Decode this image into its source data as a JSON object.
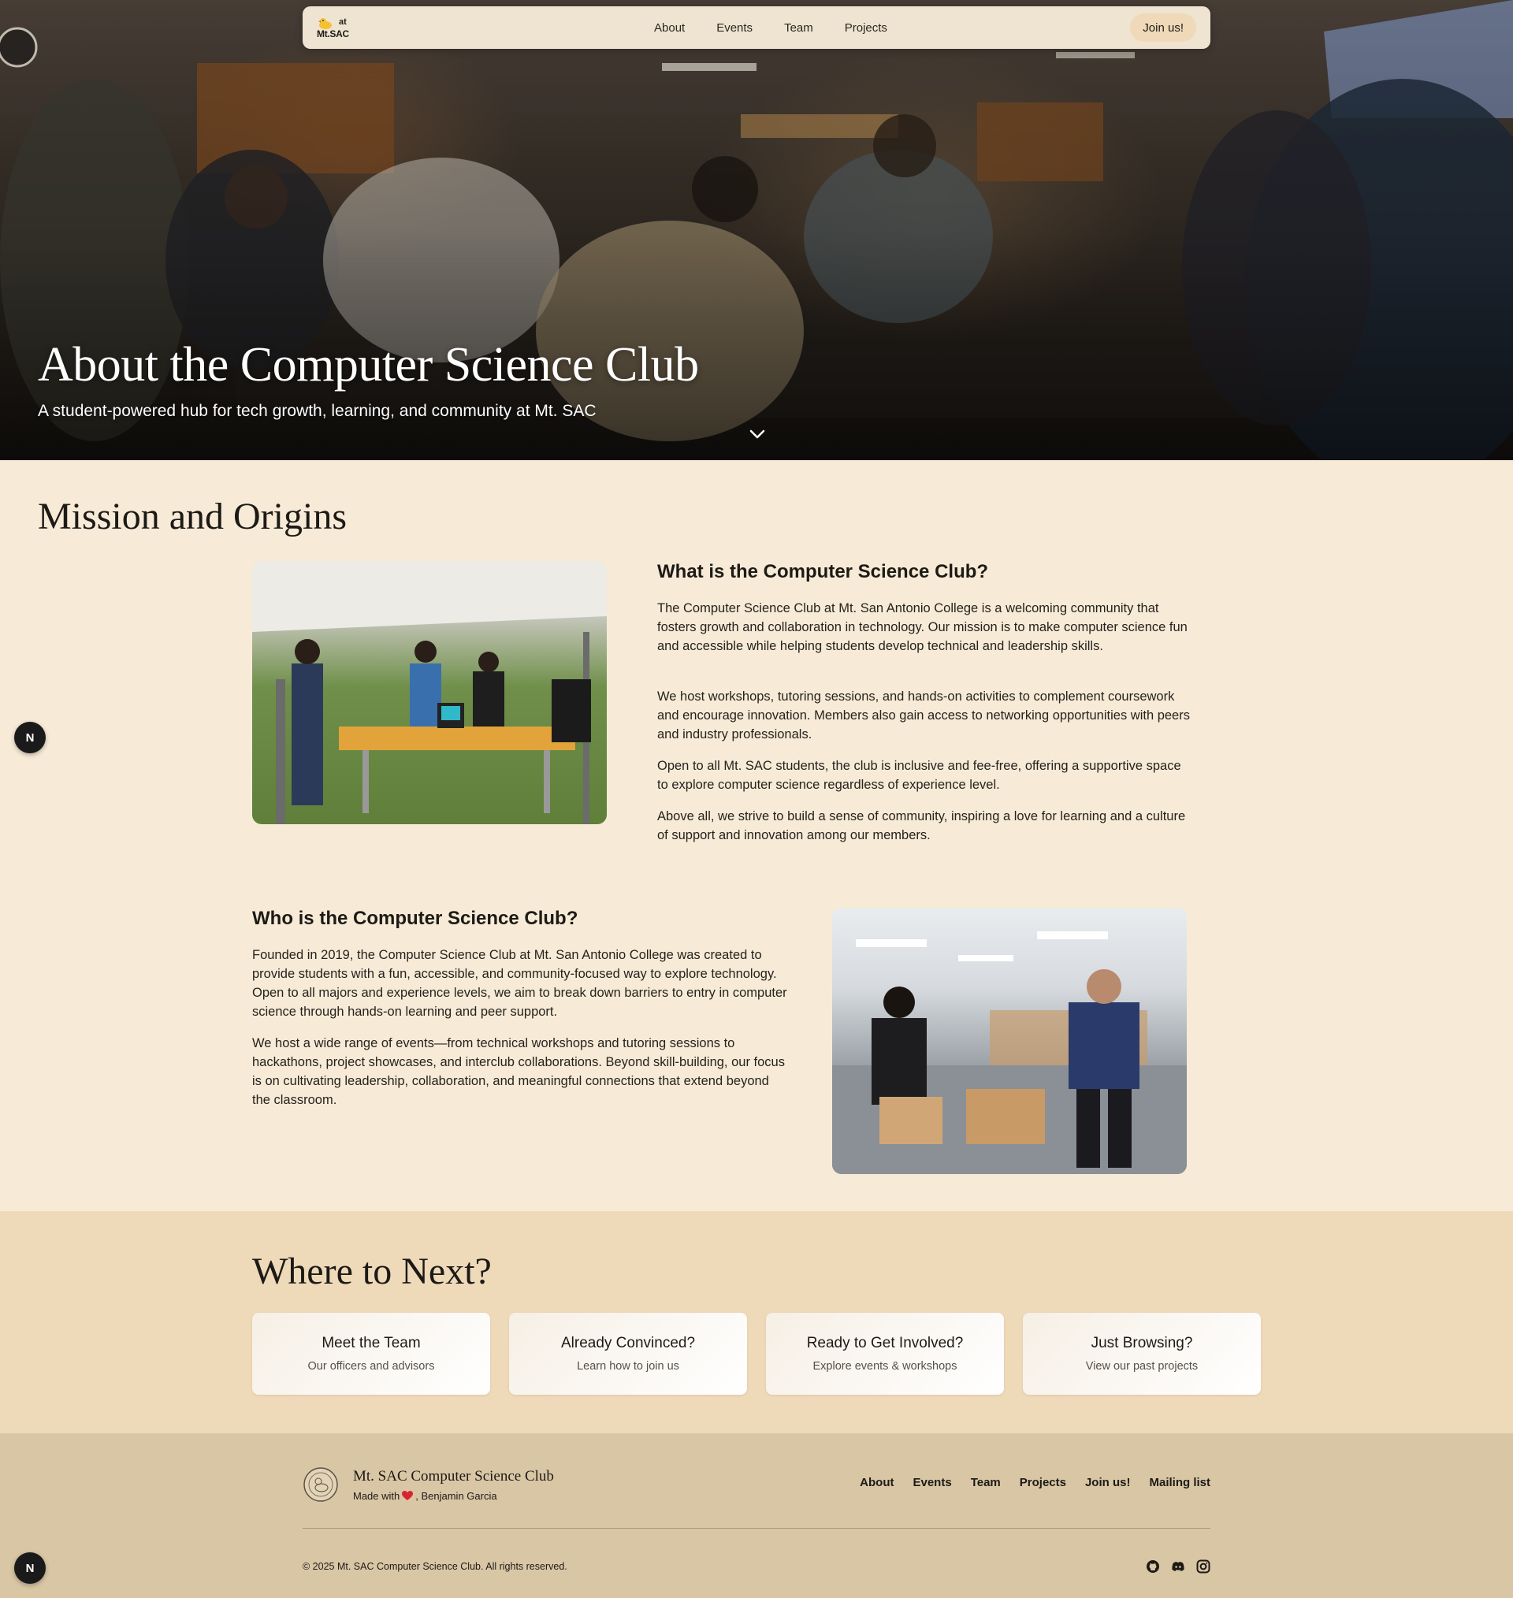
{
  "nav": {
    "logo_at": "at",
    "logo_name": "Mt.SAC",
    "links": [
      "About",
      "Events",
      "Team",
      "Projects"
    ],
    "join_label": "Join us!"
  },
  "hero": {
    "title": "About the Computer Science Club",
    "subtitle": "A student-powered hub for tech growth, learning, and community at Mt. SAC"
  },
  "mission": {
    "title": "Mission and Origins",
    "what": {
      "heading": "What is the Computer Science Club?",
      "paragraphs": [
        "The Computer Science Club at Mt. San Antonio College is a welcoming community that fosters growth and collaboration in technology. Our mission is to make computer science fun and accessible while helping students develop technical and leadership skills.",
        "We host workshops, tutoring sessions, and hands-on activities to complement coursework and encourage innovation. Members also gain access to networking opportunities with peers and industry professionals.",
        "Open to all Mt. SAC students, the club is inclusive and fee-free, offering a supportive space to explore computer science regardless of experience level.",
        "Above all, we strive to build a sense of community, inspiring a love for learning and a culture of support and innovation among our members."
      ]
    },
    "who": {
      "heading": "Who is the Computer Science Club?",
      "paragraphs": [
        "Founded in 2019, the Computer Science Club at Mt. San Antonio College was created to provide students with a fun, accessible, and community-focused way to explore technology. Open to all majors and experience levels, we aim to break down barriers to entry in computer science through hands-on learning and peer support.",
        "We host a wide range of events—from technical workshops and tutoring sessions to hackathons, project showcases, and interclub collaborations. Beyond skill-building, our focus is on cultivating leadership, collaboration, and meaningful connections that extend beyond the classroom."
      ]
    }
  },
  "next": {
    "title": "Where to Next?",
    "cards": [
      {
        "title": "Meet the Team",
        "sub": "Our officers and advisors"
      },
      {
        "title": "Already Convinced?",
        "sub": "Learn how to join us"
      },
      {
        "title": "Ready to Get Involved?",
        "sub": "Explore events & workshops"
      },
      {
        "title": "Just Browsing?",
        "sub": "View our past projects"
      }
    ]
  },
  "footer": {
    "name": "Mt. SAC Computer Science Club",
    "made_prefix": "Made with",
    "made_suffix": ", Benjamin Garcia",
    "links": [
      "About",
      "Events",
      "Team",
      "Projects",
      "Join us!",
      "Mailing list"
    ],
    "copyright": "© 2025 Mt. SAC Computer Science Club. All rights reserved."
  },
  "floating_badge": "N",
  "icons": {
    "chevron": "chevron-down-icon",
    "heart": "heart-icon",
    "socials": [
      "github-icon",
      "discord-icon",
      "instagram-icon"
    ]
  },
  "colors": {
    "page_bg": "#f7ebd7",
    "next_bg": "#eed9b9",
    "footer_bg": "#d9c6a5",
    "join_bg": "#efd9b8",
    "heart": "#d7262f"
  }
}
